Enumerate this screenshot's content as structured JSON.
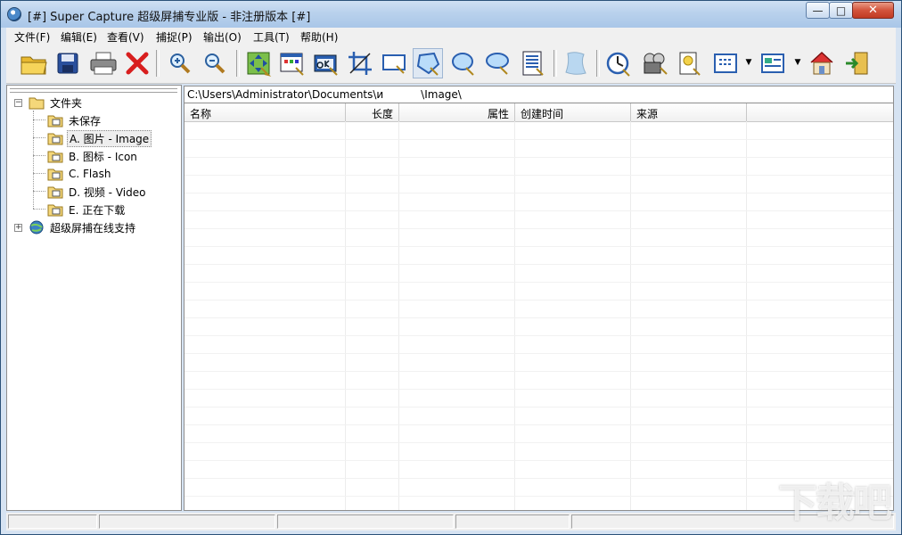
{
  "window": {
    "title": "[#] Super Capture 超级屏捕专业版 - 非注册版本 [#]",
    "minimize": "—",
    "maximize": "□",
    "close": "✕"
  },
  "menu": [
    "文件(F)",
    "编辑(E)",
    "查看(V)",
    "捕捉(P)",
    "输出(O)",
    "工具(T)",
    "帮助(H)"
  ],
  "toolbar": {
    "icons": [
      "open-folder-icon",
      "save-disk-icon",
      "printer-icon",
      "delete-x-icon",
      "zoom-in-icon",
      "zoom-out-icon",
      "capture-move-icon",
      "capture-window-icon",
      "capture-ok-icon",
      "capture-crop-icon",
      "capture-region-icon",
      "capture-polygon-icon",
      "capture-ellipse-icon",
      "capture-round-icon",
      "capture-scroll-icon",
      "capture-freehand-icon",
      "timer-capture-icon",
      "video-capture-icon",
      "light-capture-icon",
      "view-grid-icon",
      "view-list-icon",
      "home-icon",
      "exit-door-icon"
    ],
    "dropdown": "▼"
  },
  "tree": {
    "root": "文件夹",
    "children": [
      "未保存",
      "A. 图片 - Image",
      "B. 图标 - Icon",
      "C. Flash",
      "D. 视频 - Video",
      "E. 正在下载"
    ],
    "online": "超级屏捕在线支持",
    "collapse": "−",
    "expand": "+"
  },
  "path": "C:\\Users\\Administrator\\Documents\\и           \\Image\\",
  "columns": [
    "名称",
    "长度",
    "属性",
    "创建时间",
    "来源"
  ],
  "watermark": "下载吧"
}
